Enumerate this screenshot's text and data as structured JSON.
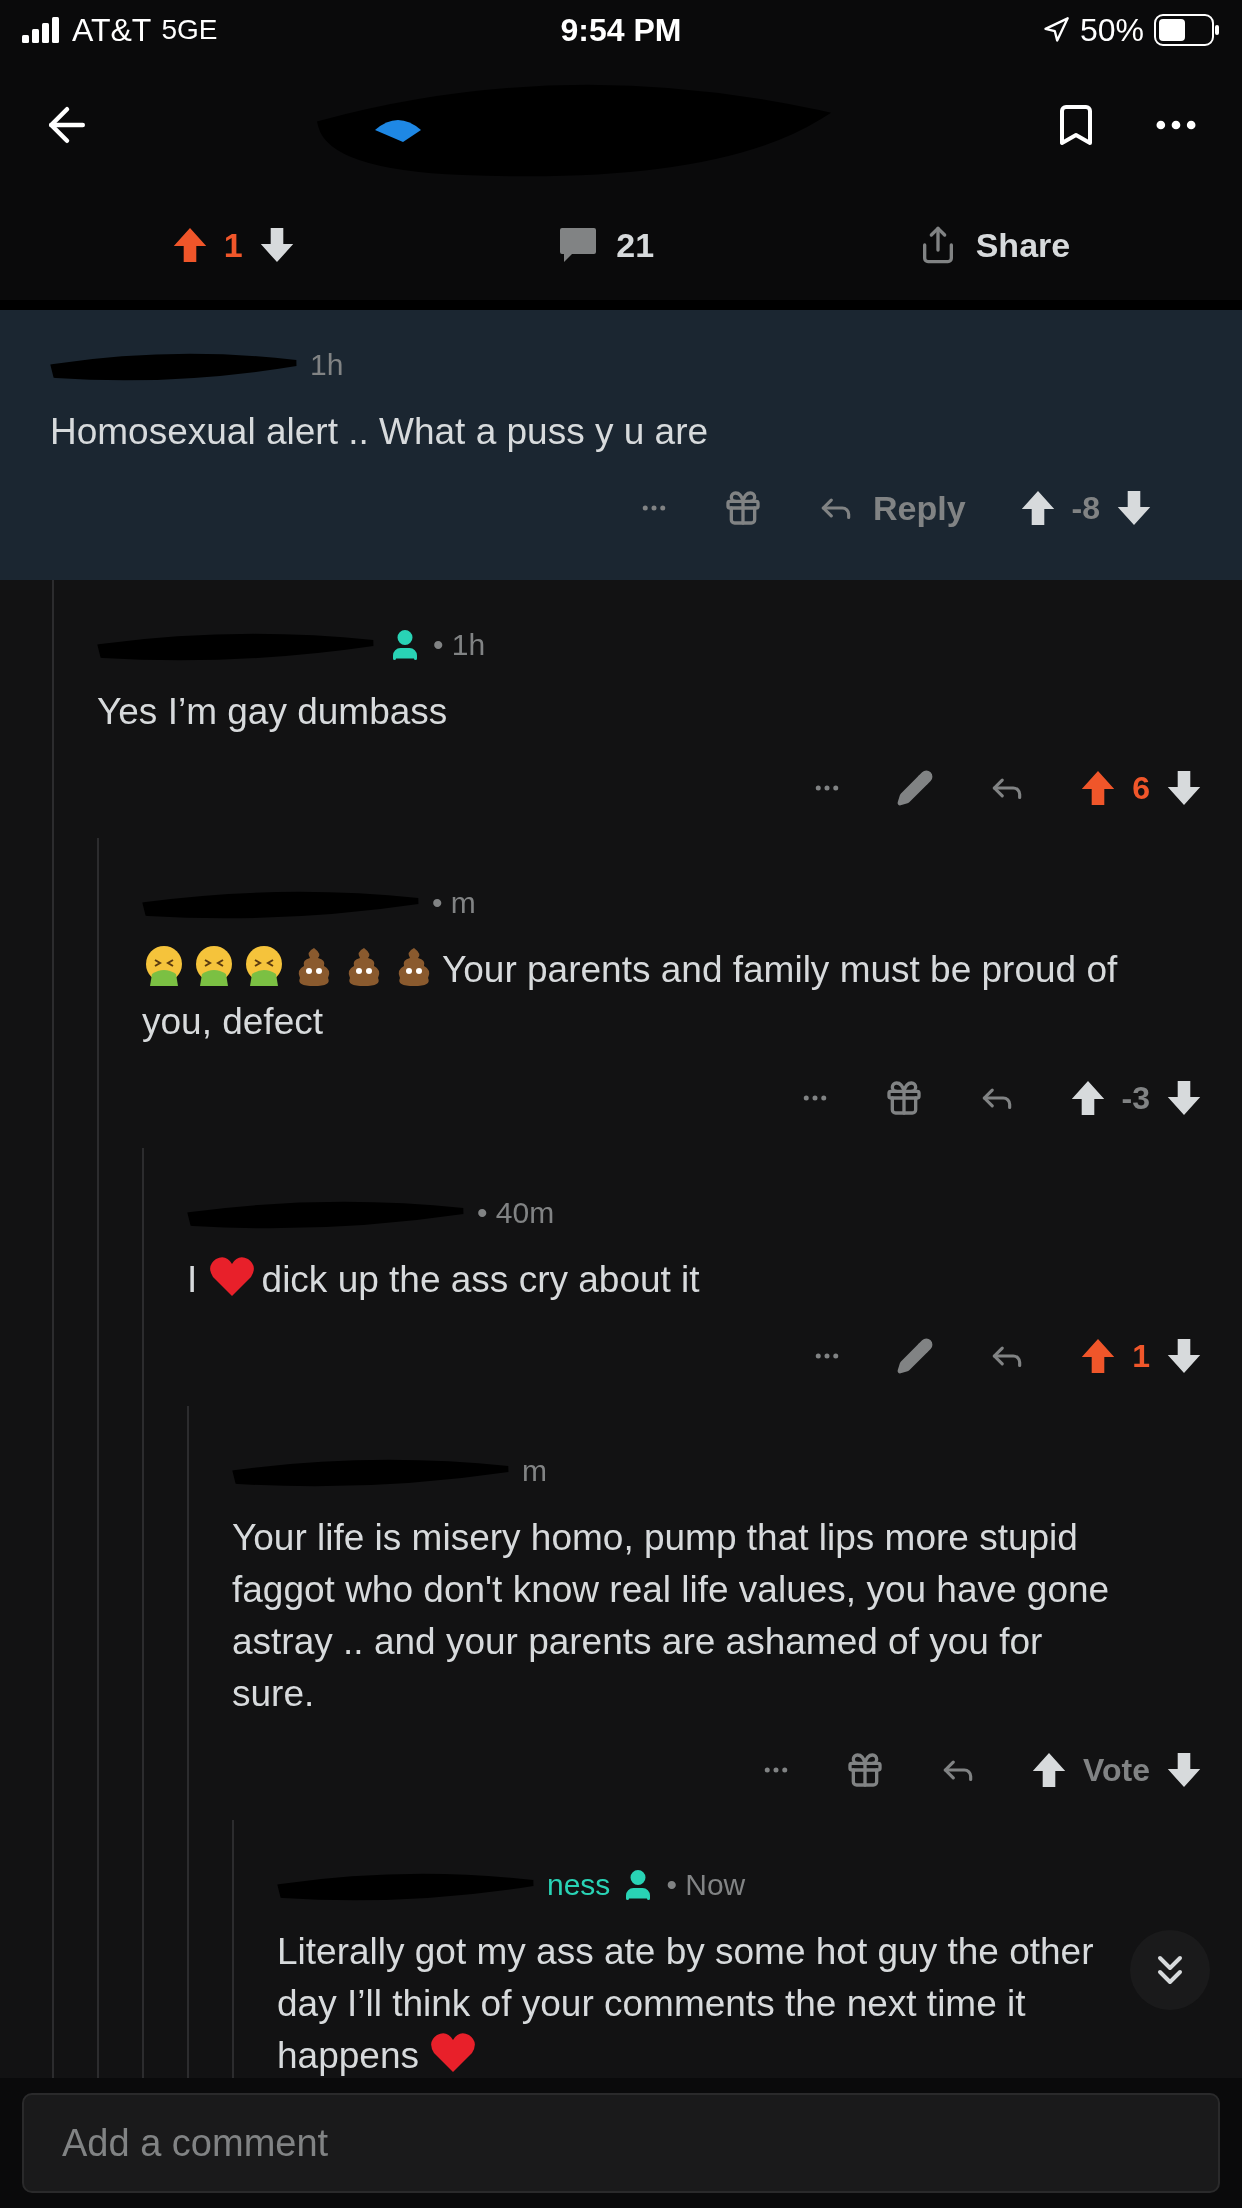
{
  "status_bar": {
    "carrier": "AT&T",
    "network": "5GE",
    "time": "9:54 PM",
    "battery": "50%"
  },
  "post_bar": {
    "upvoted": true,
    "score": "1",
    "comments": "21",
    "share": "Share"
  },
  "comments": [
    {
      "highlighted": true,
      "time": "1h",
      "segments": [
        {
          "kind": "text",
          "text": "Homosexual alert .. What a puss y u are"
        }
      ],
      "actions": {
        "kind": "gift",
        "reply_label": "Reply",
        "upvoted": false,
        "score": "-8"
      },
      "children": [
        {
          "user_icon": true,
          "time": "• 1h",
          "segments": [
            {
              "kind": "text",
              "text": "Yes I’m gay dumbass"
            }
          ],
          "actions": {
            "kind": "edit",
            "upvoted": true,
            "score": "6"
          },
          "children": [
            {
              "time": "• m",
              "segments": [
                {
                  "kind": "vomit"
                },
                {
                  "kind": "vomit"
                },
                {
                  "kind": "vomit"
                },
                {
                  "kind": "poop"
                },
                {
                  "kind": "poop"
                },
                {
                  "kind": "poop"
                },
                {
                  "kind": "text",
                  "text": "Your parents and family must be proud of you, defect"
                }
              ],
              "actions": {
                "kind": "gift",
                "upvoted": false,
                "score": "-3"
              },
              "children": [
                {
                  "time": "• 40m",
                  "segments": [
                    {
                      "kind": "text",
                      "text": "I"
                    },
                    {
                      "kind": "heart"
                    },
                    {
                      "kind": "text",
                      "text": "dick up the ass cry about it"
                    }
                  ],
                  "actions": {
                    "kind": "edit",
                    "upvoted": true,
                    "score": "1"
                  },
                  "children": [
                    {
                      "time": "m",
                      "segments": [
                        {
                          "kind": "text",
                          "text": "Your life is misery homo, pump that lips more stupid faggot who don't know real life values, you have gone astray .. and your parents are ashamed of you for sure."
                        }
                      ],
                      "actions": {
                        "kind": "gift",
                        "upvoted": false,
                        "score": "Vote"
                      },
                      "children": [
                        {
                          "author": "ness",
                          "user_icon": true,
                          "time": "• Now",
                          "segments": [
                            {
                              "kind": "text",
                              "text": "Literally got my ass ate by some hot guy the other day I’ll think of your comments the next time it happens"
                            },
                            {
                              "kind": "heart"
                            }
                          ]
                        }
                      ]
                    }
                  ]
                }
              ]
            }
          ]
        }
      ]
    }
  ],
  "composer": {
    "placeholder": "Add a comment"
  }
}
